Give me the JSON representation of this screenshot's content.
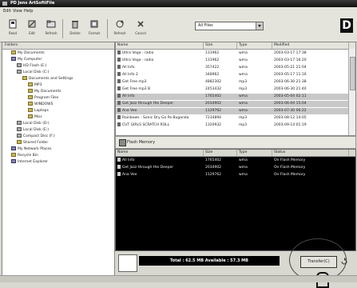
{
  "window": {
    "title": "PD Jens ArtSoftiFile"
  },
  "menu": [
    "Edit",
    "View",
    "Help"
  ],
  "toolbar": {
    "buttons": [
      "Read",
      "Edit",
      "Refresh",
      "Delete",
      "Format",
      "Refresh",
      "Cancel"
    ],
    "drive_filter": "All Files"
  },
  "logo": "D",
  "tree": {
    "header": "Folders",
    "nodes": [
      "My Documents",
      "My Computer",
      "HD Flash (E:)",
      "Local Disk (C:)",
      "Documents and Settings",
      "MP3",
      "My Documents",
      "Program Files",
      "WINDOWS",
      "Laptops",
      "Misc",
      "Local Disk (D:)",
      "Local Disk (E:)",
      "Compact Disc (F:)",
      "Shared Folder",
      "My Network Places",
      "Recycle Bin",
      "Internet Explorer"
    ]
  },
  "files": {
    "columns": [
      "Name",
      "Size",
      "Type",
      "Modified"
    ],
    "rows": [
      [
        "Ultra Vega - radio",
        "131962",
        "wma",
        "2003-03-17 17:38"
      ],
      [
        "Ultra Vega - radio",
        "131962",
        "wma",
        "2003-03-17 16:20"
      ],
      [
        "All Info",
        "357422",
        "wma",
        "2003-05-21 21:04"
      ],
      [
        "All Info 2",
        "348962",
        "wma",
        "2003-05-17 11:16"
      ],
      [
        "Get Free mp3",
        "4882302",
        "mp3",
        "2003-06-30 21:38"
      ],
      [
        "Get Free mp3 B",
        "2453432",
        "mp3",
        "2003-06-30 21:40"
      ],
      [
        "All Info",
        "1765402",
        "wma",
        "2003-05-04 02:11"
      ],
      [
        "Get Jazz through the Deeper",
        "2034902",
        "wma",
        "2003-06-04 15:04"
      ],
      [
        "Ana Vee",
        "1129762",
        "wma",
        "2003-07-30 06:22"
      ],
      [
        "Rainbows - Sonic Dry Go Pa Buganda",
        "7234894",
        "mp3",
        "2003-08-12 14:05"
      ],
      [
        "CUT GIRLS SCRATCH ROLL",
        "1320932",
        "mp3",
        "2003-09-14 01:19"
      ]
    ]
  },
  "flash": {
    "label": "Flash Memory",
    "columns": [
      "Name",
      "Size",
      "Type",
      "Status"
    ],
    "rows": [
      [
        "All Info",
        "1765402",
        "wma",
        "On Flash Memory"
      ],
      [
        "Get Jazz through the Deeper",
        "2034902",
        "wma",
        "On Flash Memory"
      ],
      [
        "Ana Vee",
        "1129762",
        "wma",
        "On Flash Memory"
      ]
    ]
  },
  "status": {
    "memory_line": "Total : 62.5 MB    Available : 57.3 MB",
    "transfer_label": "Transfer(C)"
  },
  "colors": {
    "titlebar": "#111111",
    "flash_bg": "#000000",
    "selection": "#c8c8c8"
  }
}
